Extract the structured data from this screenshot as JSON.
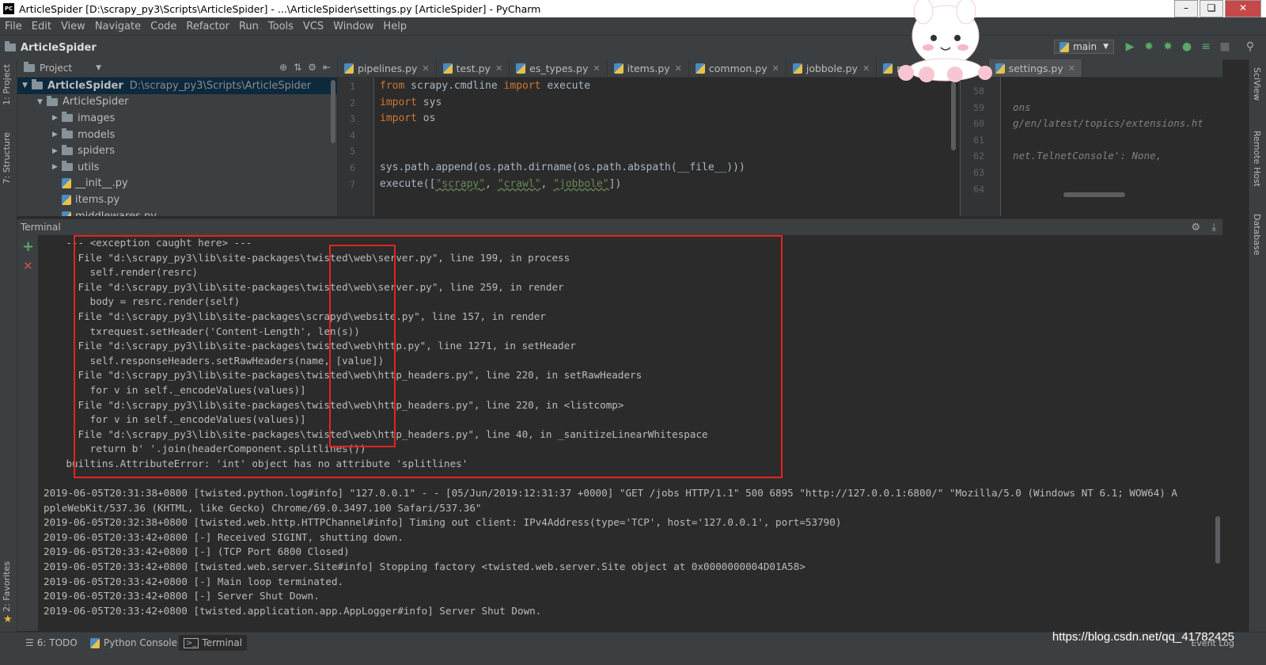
{
  "window": {
    "title": "ArticleSpider [D:\\scrapy_py3\\Scripts\\ArticleSpider] - ...\\ArticleSpider\\settings.py [ArticleSpider] - PyCharm",
    "app_icon": "PC"
  },
  "menu": [
    "File",
    "Edit",
    "View",
    "Navigate",
    "Code",
    "Refactor",
    "Run",
    "Tools",
    "VCS",
    "Window",
    "Help"
  ],
  "navbar": {
    "breadcrumb": "ArticleSpider",
    "run_config": "main"
  },
  "left_strip": {
    "project": "1: Project",
    "structure": "7: Structure",
    "favorites": "2: Favorites"
  },
  "right_strip": {
    "sciview": "SciView",
    "remote_host": "Remote Host",
    "database": "Database"
  },
  "project_panel": {
    "header": "Project",
    "tree": [
      {
        "label": "ArticleSpider",
        "path": "D:\\scrapy_py3\\Scripts\\ArticleSpider",
        "type": "folder",
        "depth": 0,
        "expanded": true
      },
      {
        "label": "ArticleSpider",
        "type": "folder",
        "depth": 1,
        "expanded": true
      },
      {
        "label": "images",
        "type": "folder",
        "depth": 2,
        "expanded": false
      },
      {
        "label": "models",
        "type": "folder",
        "depth": 2,
        "expanded": false
      },
      {
        "label": "spiders",
        "type": "folder",
        "depth": 2,
        "expanded": false
      },
      {
        "label": "utils",
        "type": "folder",
        "depth": 2,
        "expanded": false
      },
      {
        "label": "__init__.py",
        "type": "py",
        "depth": 2
      },
      {
        "label": "items.py",
        "type": "py",
        "depth": 2
      },
      {
        "label": "middlewares.py",
        "type": "py",
        "depth": 2
      }
    ]
  },
  "tabs": [
    {
      "label": "pipelines.py"
    },
    {
      "label": "test.py"
    },
    {
      "label": "es_types.py"
    },
    {
      "label": "items.py"
    },
    {
      "label": "common.py"
    },
    {
      "label": "jobbole.py"
    },
    {
      "label": "m"
    },
    {
      "label": "settings.py",
      "active": true
    }
  ],
  "editor_left": {
    "lines": [
      {
        "n": "1",
        "segs": [
          {
            "t": "from ",
            "c": "kw"
          },
          {
            "t": "scrapy.cmdline ",
            "c": ""
          },
          {
            "t": "import ",
            "c": "kw"
          },
          {
            "t": "execute",
            "c": ""
          }
        ]
      },
      {
        "n": "2",
        "segs": [
          {
            "t": "import ",
            "c": "kw"
          },
          {
            "t": "sys",
            "c": ""
          }
        ]
      },
      {
        "n": "3",
        "segs": [
          {
            "t": "import ",
            "c": "kw"
          },
          {
            "t": "os",
            "c": ""
          }
        ]
      },
      {
        "n": "4",
        "segs": []
      },
      {
        "n": "5",
        "segs": []
      },
      {
        "n": "6",
        "segs": [
          {
            "t": "sys.path.append(os.path.dirname(os.path.abspath(__file__)))",
            "c": ""
          }
        ]
      },
      {
        "n": "7",
        "segs": [
          {
            "t": "execute([",
            "c": ""
          },
          {
            "t": "\"scrapy\"",
            "c": "str"
          },
          {
            "t": ", ",
            "c": ""
          },
          {
            "t": "\"crawl\"",
            "c": "str"
          },
          {
            "t": ", ",
            "c": ""
          },
          {
            "t": "\"jobbole\"",
            "c": "str"
          },
          {
            "t": "])",
            "c": ""
          }
        ]
      }
    ]
  },
  "editor_right": {
    "lines": [
      {
        "n": "58",
        "text": ""
      },
      {
        "n": "59",
        "text": "ons"
      },
      {
        "n": "60",
        "text": "g/en/latest/topics/extensions.ht"
      },
      {
        "n": "61",
        "text": ""
      },
      {
        "n": "62",
        "text": "net.TelnetConsole': None,"
      },
      {
        "n": "63",
        "text": ""
      },
      {
        "n": "64",
        "text": ""
      }
    ]
  },
  "terminal": {
    "header": "Terminal",
    "traceback": [
      "    --- <exception caught here> ---",
      "      File \"d:\\scrapy_py3\\lib\\site-packages\\twisted\\web\\server.py\", line 199, in process",
      "        self.render(resrc)",
      "      File \"d:\\scrapy_py3\\lib\\site-packages\\twisted\\web\\server.py\", line 259, in render",
      "        body = resrc.render(self)",
      "      File \"d:\\scrapy_py3\\lib\\site-packages\\scrapyd\\website.py\", line 157, in render",
      "        txrequest.setHeader('Content-Length', len(s))",
      "      File \"d:\\scrapy_py3\\lib\\site-packages\\twisted\\web\\http.py\", line 1271, in setHeader",
      "        self.responseHeaders.setRawHeaders(name, [value])",
      "      File \"d:\\scrapy_py3\\lib\\site-packages\\twisted\\web\\http_headers.py\", line 220, in setRawHeaders",
      "        for v in self._encodeValues(values)]",
      "      File \"d:\\scrapy_py3\\lib\\site-packages\\twisted\\web\\http_headers.py\", line 220, in <listcomp>",
      "        for v in self._encodeValues(values)]",
      "      File \"d:\\scrapy_py3\\lib\\site-packages\\twisted\\web\\http_headers.py\", line 40, in _sanitizeLinearWhitespace",
      "        return b' '.join(headerComponent.splitlines())",
      "    builtins.AttributeError: 'int' object has no attribute 'splitlines'"
    ],
    "log": [
      "2019-06-05T20:31:38+0800 [twisted.python.log#info] \"127.0.0.1\" - - [05/Jun/2019:12:31:37 +0000] \"GET /jobs HTTP/1.1\" 500 6895 \"http://127.0.0.1:6800/\" \"Mozilla/5.0 (Windows NT 6.1; WOW64) A",
      "ppleWebKit/537.36 (KHTML, like Gecko) Chrome/69.0.3497.100 Safari/537.36\"",
      "2019-06-05T20:32:38+0800 [twisted.web.http.HTTPChannel#info] Timing out client: IPv4Address(type='TCP', host='127.0.0.1', port=53790)",
      "2019-06-05T20:33:42+0800 [-] Received SIGINT, shutting down.",
      "2019-06-05T20:33:42+0800 [-] (TCP Port 6800 Closed)",
      "2019-06-05T20:33:42+0800 [twisted.web.server.Site#info] Stopping factory <twisted.web.server.Site object at 0x0000000004D01A58>",
      "2019-06-05T20:33:42+0800 [-] Main loop terminated.",
      "2019-06-05T20:33:42+0800 [-] Server Shut Down.",
      "2019-06-05T20:33:42+0800 [twisted.application.app.AppLogger#info] Server Shut Down."
    ]
  },
  "bottom_tabs": {
    "todo": "6: TODO",
    "python_console": "Python Console",
    "terminal": "Terminal"
  },
  "watermark": "https://blog.csdn.net/qq_41782425",
  "event_log": "Event Log",
  "colors": {
    "highlight_box": "#e5231f",
    "keyword": "#cc7832",
    "string": "#6a8759",
    "background": "#2b2b2b",
    "panel": "#3c3f41"
  }
}
